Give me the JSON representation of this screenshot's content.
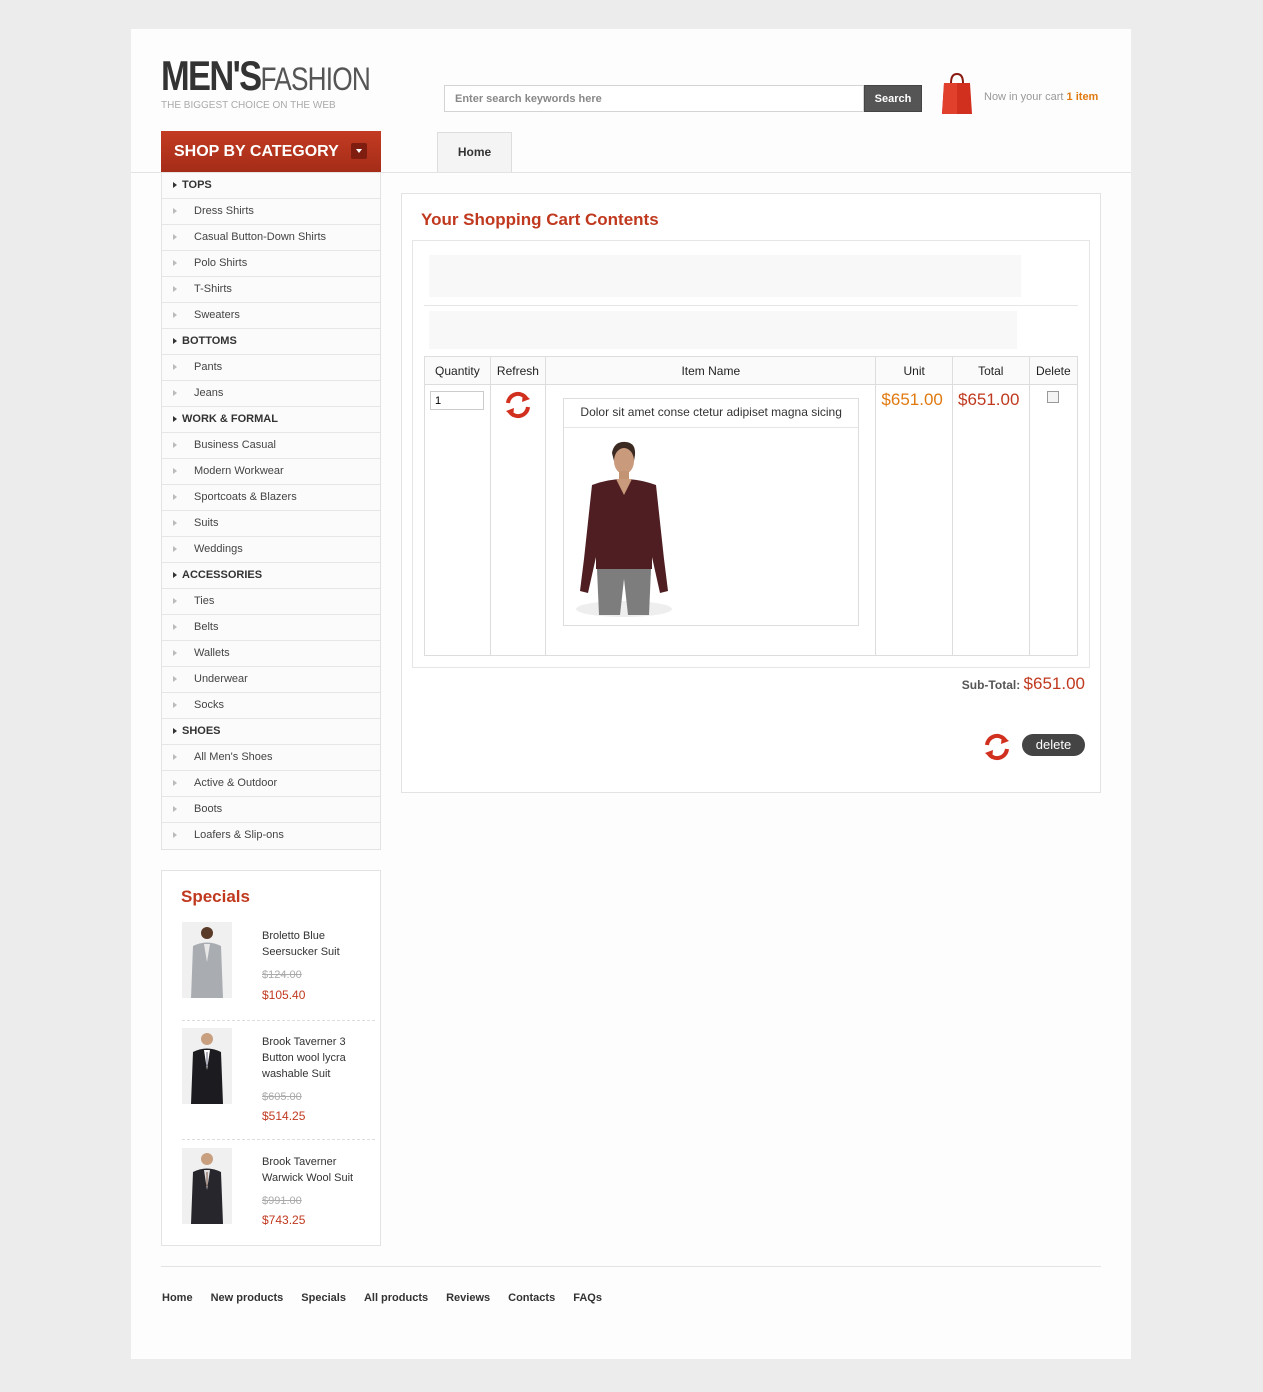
{
  "logo": {
    "main": "MEN'S",
    "sub": "FASHION",
    "tagline": "THE BIGGEST CHOICE ON THE WEB"
  },
  "search": {
    "placeholder": "Enter search keywords here",
    "button": "Search"
  },
  "cart_summary": {
    "prefix": "Now in your cart",
    "count": "1 item"
  },
  "category_header": "SHOP BY CATEGORY",
  "nav_tabs": [
    "Home"
  ],
  "categories": [
    {
      "label": "TOPS",
      "level": "top"
    },
    {
      "label": "Dress Shirts",
      "level": "sub"
    },
    {
      "label": "Casual Button-Down Shirts",
      "level": "sub"
    },
    {
      "label": "Polo Shirts",
      "level": "sub"
    },
    {
      "label": "T-Shirts",
      "level": "sub"
    },
    {
      "label": "Sweaters",
      "level": "sub"
    },
    {
      "label": "BOTTOMS",
      "level": "top"
    },
    {
      "label": "Pants",
      "level": "sub"
    },
    {
      "label": "Jeans",
      "level": "sub"
    },
    {
      "label": "WORK & FORMAL",
      "level": "top"
    },
    {
      "label": "Business Casual",
      "level": "sub"
    },
    {
      "label": "Modern Workwear",
      "level": "sub"
    },
    {
      "label": "Sportcoats & Blazers",
      "level": "sub"
    },
    {
      "label": "Suits",
      "level": "sub"
    },
    {
      "label": "Weddings",
      "level": "sub"
    },
    {
      "label": "ACCESSORIES",
      "level": "top"
    },
    {
      "label": "Ties",
      "level": "sub"
    },
    {
      "label": "Belts",
      "level": "sub"
    },
    {
      "label": "Wallets",
      "level": "sub"
    },
    {
      "label": "Underwear",
      "level": "sub"
    },
    {
      "label": "Socks",
      "level": "sub"
    },
    {
      "label": "SHOES",
      "level": "top"
    },
    {
      "label": "All Men's Shoes",
      "level": "sub"
    },
    {
      "label": "Active & Outdoor",
      "level": "sub"
    },
    {
      "label": "Boots",
      "level": "sub"
    },
    {
      "label": "Loafers & Slip-ons",
      "level": "sub"
    }
  ],
  "specials": {
    "title": "Specials",
    "items": [
      {
        "name": "Broletto Blue Seersucker Suit",
        "old_price": "$124.00",
        "new_price": "$105.40"
      },
      {
        "name": "Brook Taverner 3 Button wool lycra washable Suit",
        "old_price": "$605.00",
        "new_price": "$514.25"
      },
      {
        "name": "Brook Taverner Warwick Wool Suit",
        "old_price": "$991.00",
        "new_price": "$743.25"
      }
    ]
  },
  "cart": {
    "title": "Your Shopping Cart Contents",
    "columns": {
      "quantity": "Quantity",
      "refresh": "Refresh",
      "item_name": "Item Name",
      "unit": "Unit",
      "total": "Total",
      "delete": "Delete"
    },
    "row": {
      "quantity": "1",
      "item_name": "Dolor sit amet conse ctetur adipiset magna sicing",
      "unit": "$651.00",
      "total": "$651.00"
    },
    "subtotal_label": "Sub-Total:",
    "subtotal_value": "$651.00",
    "delete_button": "delete"
  },
  "footer_links": [
    "Home",
    "New products",
    "Specials",
    "All products",
    "Reviews",
    "Contacts",
    "FAQs"
  ],
  "colors": {
    "accent": "#c0391f",
    "price_orange": "#e07a10",
    "page_bg": "#ececec"
  }
}
